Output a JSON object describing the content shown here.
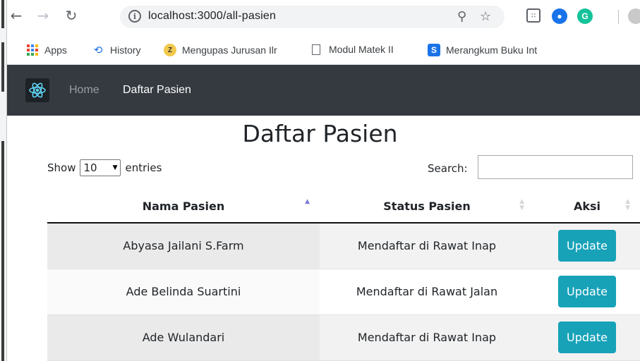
{
  "browser": {
    "url": "localhost:3000/all-pasien",
    "bookmarks": [
      {
        "label": "Apps"
      },
      {
        "label": "History"
      },
      {
        "label": "Mengupas Jurusan Ilr"
      },
      {
        "label": "Modul Matek II"
      },
      {
        "label": "Merangkum Buku Int"
      }
    ]
  },
  "navbar": {
    "links": [
      {
        "label": "Home"
      },
      {
        "label": "Daftar Pasien"
      }
    ]
  },
  "page": {
    "title": "Daftar Pasien",
    "show_label": "Show",
    "entries_value": "10",
    "entries_label": "entries",
    "search_label": "Search:",
    "search_value": ""
  },
  "table": {
    "columns": [
      "Nama Pasien",
      "Status Pasien",
      "Aksi"
    ],
    "rows": [
      {
        "nama": "Abyasa Jailani S.Farm",
        "status": "Mendaftar di Rawat Inap",
        "aksi": "Update"
      },
      {
        "nama": "Ade Belinda Suartini",
        "status": "Mendaftar di Rawat Jalan",
        "aksi": "Update"
      },
      {
        "nama": "Ade Wulandari",
        "status": "Mendaftar di Rawat Inap",
        "aksi": "Update"
      }
    ]
  },
  "colors": {
    "navbar_bg": "#343a40",
    "nav_active": "#ffffff",
    "nav_inactive": "#9a9da0",
    "button_bg": "#17a2b8",
    "sort_active": "#7b7bd6"
  }
}
